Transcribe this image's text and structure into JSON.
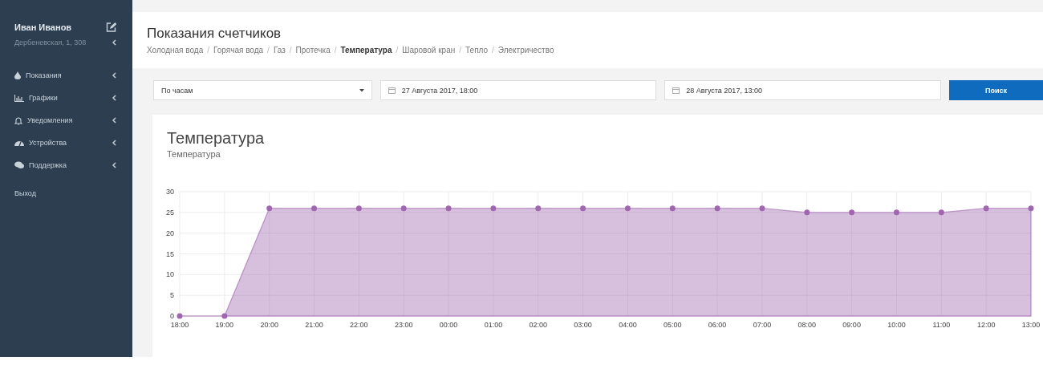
{
  "sidebar": {
    "user_name": "Иван Иванов",
    "address": "Дербеневская, 1, 308",
    "menu": [
      {
        "label": "Показания"
      },
      {
        "label": "Графики"
      },
      {
        "label": "Уведомления"
      },
      {
        "label": "Устройства"
      },
      {
        "label": "Поддержка"
      }
    ],
    "logout": "Выход"
  },
  "header": {
    "title": "Показания счетчиков",
    "breadcrumbs": {
      "separator": "/",
      "items": [
        {
          "label": "Холодная вода",
          "selected": false
        },
        {
          "label": "Горячая вода",
          "selected": false
        },
        {
          "label": "Газ",
          "selected": false
        },
        {
          "label": "Протечка",
          "selected": false
        },
        {
          "label": "Температура",
          "selected": true
        },
        {
          "label": "Шаровой кран",
          "selected": false
        },
        {
          "label": "Тепло",
          "selected": false
        },
        {
          "label": "Электричество",
          "selected": false
        }
      ]
    }
  },
  "filters": {
    "period": "По часам",
    "date_from": "27 Августа 2017, 18:00",
    "date_to": "28 Августа 2017, 13:00",
    "search_button": "Поиск"
  },
  "chart_card": {
    "title": "Температура",
    "subtitle": "Температура",
    "chart_data": {
      "type": "area",
      "categories": [
        "18:00",
        "19:00",
        "20:00",
        "21:00",
        "22:00",
        "23:00",
        "00:00",
        "01:00",
        "02:00",
        "03:00",
        "04:00",
        "05:00",
        "06:00",
        "07:00",
        "08:00",
        "09:00",
        "10:00",
        "11:00",
        "12:00",
        "13:00"
      ],
      "grid": true,
      "series": [
        {
          "color": "#a066b0",
          "values": [
            0,
            0,
            26,
            26,
            26,
            26,
            26,
            26,
            26,
            26,
            26,
            26,
            26,
            26,
            25,
            25,
            25,
            25,
            26,
            26
          ]
        }
      ],
      "ylim": [
        0,
        30
      ],
      "yticks": [
        0,
        5,
        10,
        15,
        20,
        25,
        30
      ]
    }
  }
}
